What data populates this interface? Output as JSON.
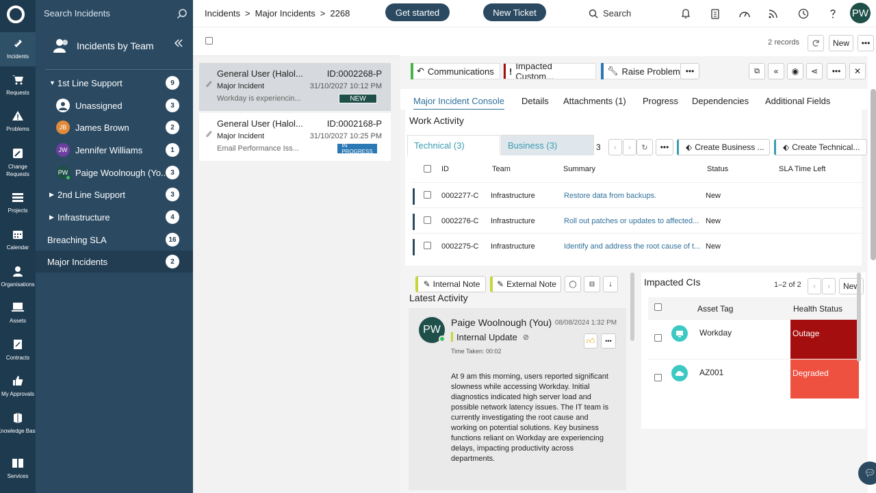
{
  "rail": {
    "items": [
      {
        "label": "Incidents",
        "icon": "incident-icon"
      },
      {
        "label": "Requests",
        "icon": "cart-icon"
      },
      {
        "label": "Problems",
        "icon": "warning-icon"
      },
      {
        "label": "Change Requests",
        "icon": "edit-icon"
      },
      {
        "label": "Projects",
        "icon": "projects-icon"
      },
      {
        "label": "Calendar",
        "icon": "calendar-icon"
      },
      {
        "label": "Organisations",
        "icon": "person-icon"
      },
      {
        "label": "Assets",
        "icon": "monitor-icon"
      },
      {
        "label": "Contracts",
        "icon": "contract-icon"
      },
      {
        "label": "My Approvals",
        "icon": "thumbs-up-icon"
      },
      {
        "label": "Knowledge Base",
        "icon": "knowledge-icon"
      },
      {
        "label": "Services",
        "icon": "book-icon"
      }
    ]
  },
  "nav": {
    "search_placeholder": "Search Incidents",
    "header": "Incidents by Team",
    "groups": [
      {
        "label": "1st Line Support",
        "count": "9"
      },
      {
        "label": "Unassigned",
        "count": "3"
      },
      {
        "label": "James Brown",
        "initials": "JB",
        "count": "2",
        "color": "#e08a3a"
      },
      {
        "label": "Jennifer Williams",
        "initials": "JW",
        "count": "1",
        "color": "#6b3fa0"
      },
      {
        "label": "Paige Woolnough (Yo...",
        "initials": "PW",
        "count": "3",
        "color": "#1e4f48"
      },
      {
        "label": "2nd Line Support",
        "count": "3"
      },
      {
        "label": "Infrastructure",
        "count": "4"
      },
      {
        "label": "Breaching SLA",
        "count": "16"
      },
      {
        "label": "Major Incidents",
        "count": "2"
      }
    ]
  },
  "topbar": {
    "breadcrumb": [
      "Incidents",
      ">",
      "Major Incidents",
      ">",
      "2268"
    ],
    "get_started": "Get started",
    "new_ticket": "New Ticket",
    "search": "Search",
    "avatar": "PW"
  },
  "list": {
    "records": "2 records",
    "new_label": "New",
    "cards": [
      {
        "title": "General User (Halol...",
        "id": "ID:0002268-P",
        "type": "Major Incident",
        "date": "31/10/2027 10:12 PM",
        "summary": "Workday is experiencin...",
        "status": "NEW",
        "status_color": "#1e4f48"
      },
      {
        "title": "General User (Halol...",
        "id": "ID:0002168-P",
        "type": "Major Incident",
        "date": "31/10/2027 10:25 PM",
        "summary": "Email Performance Iss...",
        "status": "IN PROGRESS",
        "status_color": "#2b78b5"
      }
    ]
  },
  "actions": {
    "communications": "Communications",
    "impacted": "Impacted Custom...",
    "raise_problem": "Raise Problem"
  },
  "tabs": [
    "Major Incident Console",
    "Details",
    "Attachments (1)",
    "Progress",
    "Dependencies",
    "Additional Fields"
  ],
  "work": {
    "title": "Work Activity",
    "tab_technical": "Technical (3)",
    "tab_business": "Business (3)",
    "count": "3",
    "create_business": "Create Business ...",
    "create_technical": "Create Technical...",
    "columns": [
      "ID",
      "Team",
      "Summary",
      "Status",
      "SLA Time Left"
    ],
    "rows": [
      {
        "id": "0002277-C",
        "team": "Infrastructure",
        "summary": "Restore data from backups.",
        "status": "New"
      },
      {
        "id": "0002276-C",
        "team": "Infrastructure",
        "summary": "Roll out patches or updates to affected...",
        "status": "New"
      },
      {
        "id": "0002275-C",
        "team": "Infrastructure",
        "summary": "Identify and address the root cause of t...",
        "status": "New"
      }
    ]
  },
  "activity": {
    "internal_note": "Internal Note",
    "external_note": "External Note",
    "title": "Latest Activity",
    "author": "Paige Woolnough (You)",
    "avatar": "PW",
    "timestamp": "08/08/2024 1:32 PM",
    "kind": "Internal Update",
    "time_taken": "Time Taken: 00:02",
    "body": "At 9 am this morning, users reported significant slowness while accessing Workday. Initial diagnostics indicated high server load and possible network latency issues. The IT team is currently investigating the root cause and working on potential solutions. Key business functions reliant on Workday are experiencing delays, impacting productivity across departments."
  },
  "cis": {
    "title": "Impacted CIs",
    "paging": "1–2 of 2",
    "new_label": "New",
    "col_asset": "Asset Tag",
    "col_health": "Health Status",
    "rows": [
      {
        "asset": "Workday",
        "health": "Outage",
        "color": "#a50e0e"
      },
      {
        "asset": "AZ001",
        "health": "Degraded",
        "color": "#ef5140"
      }
    ]
  }
}
